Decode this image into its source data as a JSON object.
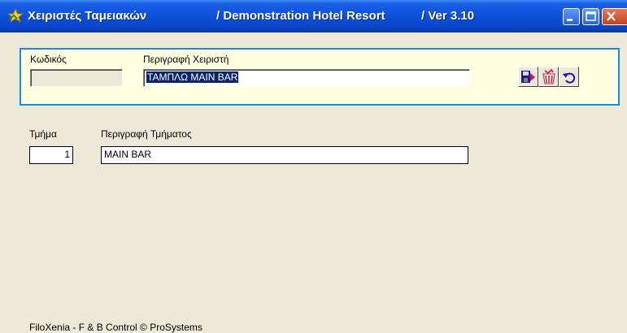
{
  "window": {
    "title": "Χειριστές Ταμειακών",
    "hotel": "/ Demonstration Hotel Resort",
    "version": "/  Ver  3.10"
  },
  "header": {
    "code_label": "Κωδικός",
    "code_value": "",
    "description_label": "Περιγραφή Χειριστή",
    "description_value": "ΤΑΜΠΛΩ MAIN BAR"
  },
  "toolbar": [
    {
      "name": "save",
      "icon": "save-exit-icon"
    },
    {
      "name": "delete",
      "icon": "trash-icon"
    },
    {
      "name": "undo",
      "icon": "undo-icon"
    }
  ],
  "section": {
    "department_label": "Τμήμα",
    "department_value": "1",
    "department_description_label": "Περιγραφή Τμήματος",
    "department_description_value": "MAIN BAR"
  },
  "footer": {
    "text": "FiloXenia - F & B Control  © ProSystems"
  }
}
